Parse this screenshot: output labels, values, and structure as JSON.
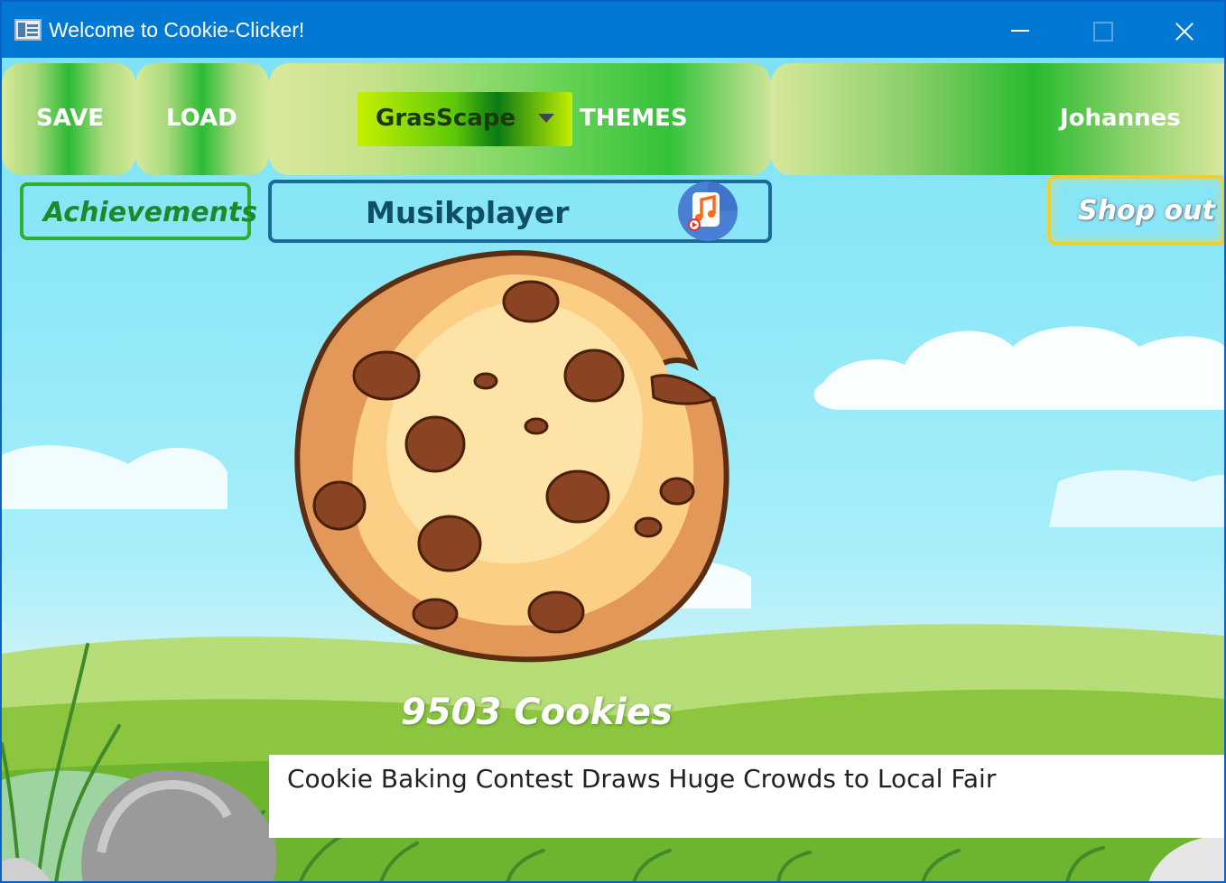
{
  "window": {
    "title": "Welcome to Cookie-Clicker!"
  },
  "topbar": {
    "save_label": "SAVE",
    "load_label": "LOAD",
    "theme_selected": "GrasScape",
    "themes_label": "THEMES",
    "user_name": "Johannes"
  },
  "row2": {
    "achievements_label": "Achievements",
    "musicplayer_label": "Musikplayer",
    "shop_label": "Shop out"
  },
  "game": {
    "cookie_count": "9503 Cookies",
    "news_text": "Cookie Baking Contest Draws Huge Crowds to Local Fair"
  },
  "icons": {
    "music": "music-note-icon",
    "cookie": "cookie-icon",
    "dropdown": "chevron-down-icon"
  },
  "colors": {
    "titlebar": "#0078d4",
    "grass_green": "#2cbb34",
    "achievements_border": "#2fae2f",
    "music_border": "#1d6a9a",
    "shop_border": "#f0cf2a"
  }
}
